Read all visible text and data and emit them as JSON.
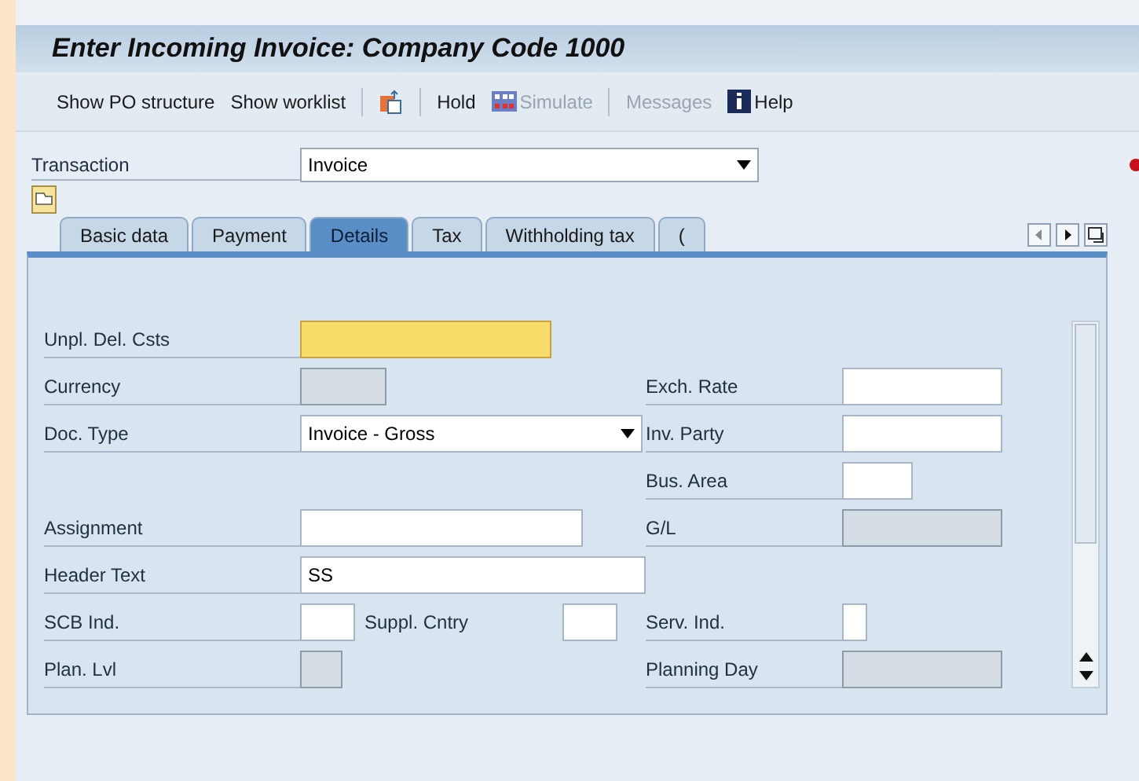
{
  "window": {
    "title": "Enter Incoming Invoice: Company Code 1000"
  },
  "toolbar": [
    {
      "kind": "text",
      "label": "Show PO structure",
      "disabled": false
    },
    {
      "kind": "text",
      "label": "Show worklist",
      "disabled": false
    },
    {
      "kind": "separator"
    },
    {
      "kind": "icon"
    },
    {
      "kind": "separator"
    },
    {
      "kind": "text",
      "label": "Hold",
      "disabled": false
    },
    {
      "kind": "simulate",
      "label": "Simulate",
      "disabled": true
    },
    {
      "kind": "separator"
    },
    {
      "kind": "text",
      "label": "Messages",
      "disabled": true
    },
    {
      "kind": "help",
      "label": "Help",
      "disabled": false
    }
  ],
  "transaction": {
    "label": "Transaction",
    "value": "Invoice"
  },
  "tabs": [
    {
      "label": "Basic data",
      "selected": false
    },
    {
      "label": "Payment",
      "selected": false
    },
    {
      "label": "Details",
      "selected": true
    },
    {
      "label": "Tax",
      "selected": false
    },
    {
      "label": "Withholding tax",
      "selected": false
    },
    {
      "label": "(",
      "selected": false
    }
  ],
  "rows": [
    {
      "left": {
        "label": "Unpl. Del. Csts",
        "field": {
          "kind": "input",
          "required": true,
          "disabled": false
        }
      }
    },
    {
      "left": {
        "label": "Currency",
        "field": {
          "kind": "input",
          "required": false,
          "disabled": true
        }
      },
      "right": {
        "label": "Exch. Rate",
        "field": {
          "kind": "input",
          "required": false,
          "disabled": false
        }
      }
    },
    {
      "left": {
        "label": "Doc. Type",
        "field": {
          "kind": "dropdown",
          "required": false,
          "disabled": false,
          "value": "Invoice - Gross"
        }
      },
      "right": {
        "label": "Inv. Party",
        "field": {
          "kind": "input",
          "required": false,
          "disabled": false
        }
      }
    },
    {
      "right": {
        "label": "Bus. Area",
        "field": {
          "kind": "input",
          "required": false,
          "disabled": false
        }
      }
    },
    {
      "left": {
        "label": "Assignment",
        "field": {
          "kind": "input",
          "required": false,
          "disabled": false
        }
      },
      "right": {
        "label": "G/L",
        "field": {
          "kind": "input",
          "required": false,
          "disabled": true
        }
      }
    },
    {
      "left": {
        "label": "Header Text",
        "field": {
          "kind": "input",
          "required": false,
          "disabled": false,
          "value": "SS"
        }
      }
    },
    {
      "left": {
        "label": "SCB Ind.",
        "field": {
          "kind": "input",
          "required": false,
          "disabled": false
        }
      },
      "extra": {
        "label": "Suppl. Cntry",
        "field": {
          "kind": "input",
          "required": false,
          "disabled": false
        }
      },
      "right": {
        "label": "Serv. Ind.",
        "field": {
          "kind": "input",
          "required": false,
          "disabled": false
        }
      }
    },
    {
      "left": {
        "label": "Plan. Lvl",
        "field": {
          "kind": "input",
          "required": false,
          "disabled": true
        }
      },
      "right": {
        "label": "Planning Day",
        "field": {
          "kind": "input",
          "required": false,
          "disabled": true
        }
      }
    }
  ]
}
